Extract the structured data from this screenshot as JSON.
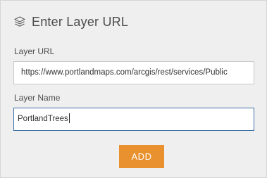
{
  "header": {
    "icon": "layers-icon",
    "title": "Enter Layer URL"
  },
  "form": {
    "url_label": "Layer URL",
    "url_value": "https://www.portlandmaps.com/arcgis/rest/services/Public",
    "name_label": "Layer Name",
    "name_value": "PortlandTrees"
  },
  "actions": {
    "add_label": "ADD"
  },
  "colors": {
    "panel_background": "#efefef",
    "accent_button": "#e8912e",
    "focus_border": "#3c6fa8"
  }
}
